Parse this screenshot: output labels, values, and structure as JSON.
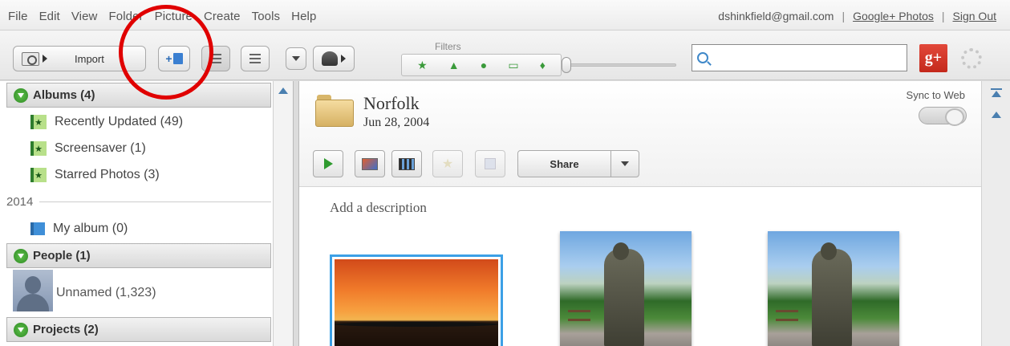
{
  "menu": {
    "items": [
      "File",
      "Edit",
      "View",
      "Folder",
      "Picture",
      "Create",
      "Tools",
      "Help"
    ],
    "account_email": "dshinkfield@gmail.com",
    "separator": "|",
    "gplus_photos": "Google+ Photos",
    "sign_out": "Sign Out"
  },
  "toolbar": {
    "import_label": "Import",
    "filters_label": "Filters",
    "search_placeholder": "",
    "search_value": "",
    "gplus_badge": "g+",
    "filter_icons": [
      "star-icon",
      "upload-icon",
      "person-icon",
      "movie-icon",
      "geotag-icon"
    ]
  },
  "sidebar": {
    "albums": {
      "header": "Albums (4)",
      "items": [
        {
          "label": "Recently Updated (49)",
          "icon": "star-album-icon"
        },
        {
          "label": "Screensaver (1)",
          "icon": "star-album-icon"
        },
        {
          "label": "Starred Photos (3)",
          "icon": "star-album-icon"
        }
      ],
      "year": "2014",
      "user_albums": [
        {
          "label": "My album (0)",
          "icon": "album-icon"
        }
      ]
    },
    "people": {
      "header": "People (1)",
      "items": [
        {
          "label": "Unnamed (1,323)",
          "icon": "person-thumbnail"
        }
      ]
    },
    "projects": {
      "header": "Projects (2)"
    }
  },
  "main": {
    "folder_title": "Norfolk",
    "folder_date": "Jun 28, 2004",
    "sync_label": "Sync to Web",
    "share_label": "Share",
    "description_placeholder": "Add a description"
  },
  "colors": {
    "highlight_circle": "#e00000",
    "selection_border": "#3ca0e6",
    "gplus_red": "#d23a2c",
    "filter_green": "#3a9a3a"
  }
}
